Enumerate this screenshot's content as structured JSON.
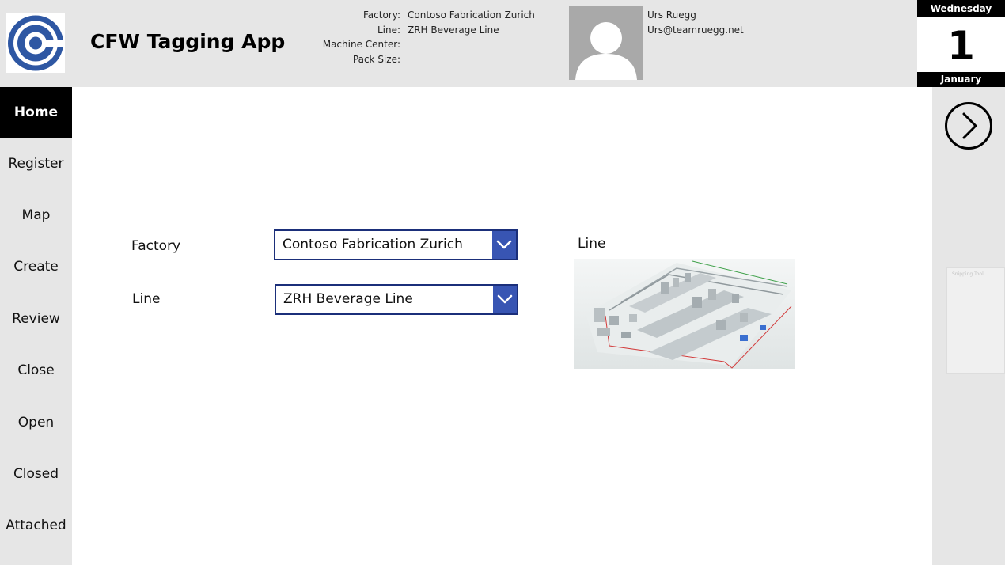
{
  "app": {
    "title": "CFW Tagging App"
  },
  "header": {
    "labels": [
      "Factory:",
      "Line:",
      "Machine Center:",
      "Pack Size:"
    ],
    "values": [
      "Contoso Fabrication Zurich",
      "ZRH Beverage Line",
      "",
      ""
    ]
  },
  "user": {
    "name": "Urs Ruegg",
    "email": "Urs@teamruegg.net"
  },
  "calendar": {
    "weekday": "Wednesday",
    "day": "1",
    "month": "January"
  },
  "nav": {
    "items": [
      {
        "label": "Home",
        "active": true
      },
      {
        "label": "Register"
      },
      {
        "label": "Map"
      },
      {
        "label": "Create"
      },
      {
        "label": "Review"
      },
      {
        "label": "Close"
      },
      {
        "label": "Open"
      },
      {
        "label": "Closed"
      },
      {
        "label": "Attached"
      }
    ]
  },
  "form": {
    "factory_label": "Factory",
    "factory_value": "Contoso Fabrication Zurich",
    "line_label": "Line",
    "line_value": "ZRH Beverage Line"
  },
  "preview": {
    "title": "Line"
  },
  "snip": {
    "text": "Snipping Tool"
  },
  "colors": {
    "accent": "#3855b3",
    "dropdown_border": "#1b2f7a",
    "logo_blue": "#2e57a3",
    "chrome_bg": "#e6e6e6"
  },
  "icons": {
    "logo": "concentric-c-logo",
    "next": "chevron-right-circle-icon",
    "dropdown": "chevron-down-icon",
    "avatar": "person-silhouette-icon"
  }
}
